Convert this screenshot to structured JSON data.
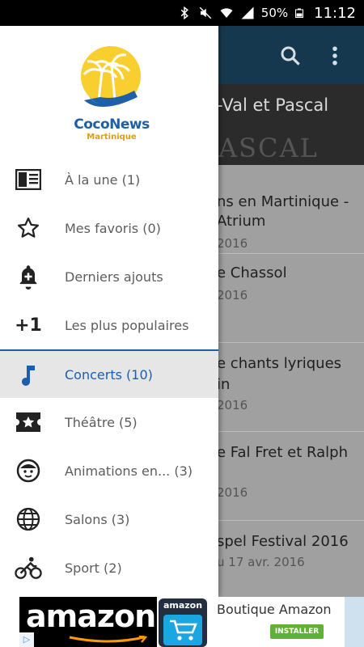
{
  "status_bar": {
    "battery": "50%",
    "time": "11:12",
    "icons": [
      "bluetooth-icon",
      "mute-icon",
      "wifi-icon",
      "signal-icon",
      "battery-icon"
    ]
  },
  "background": {
    "hero_title": "-Val et Pascal",
    "hero_deco": "ASCAL",
    "cards": [
      {
        "title_line1": "ns en Martinique -",
        "title_line2": " Atrium",
        "date": "2016"
      },
      {
        "title_line1": "e Chassol",
        "title_line2": "",
        "date": "2016"
      },
      {
        "title_line1": "e chants lyriques",
        "title_line2": "in",
        "date": "2016"
      },
      {
        "title_line1": "e Fal Fret et Ralph",
        "title_line2": "",
        "date": "2016"
      },
      {
        "title_line1": "spel Festival 2016",
        "title_line2": "",
        "date": "u 17 avr. 2016"
      }
    ]
  },
  "drawer": {
    "logo": {
      "brand": "CocoNews",
      "region": "Martinique"
    },
    "items": [
      {
        "label": "À la une (1)",
        "icon": "newspaper-icon"
      },
      {
        "label": "Mes favoris (0)",
        "icon": "star-icon"
      },
      {
        "label": "Derniers ajouts",
        "icon": "bell-plus-icon"
      },
      {
        "label": "Les plus populaires",
        "icon": "plus-one-icon",
        "icon_text": "+1"
      },
      {
        "label": "Concerts (10)",
        "icon": "music-note-icon"
      },
      {
        "label": "Théâtre (5)",
        "icon": "ticket-star-icon"
      },
      {
        "label": "Animations en... (3)",
        "icon": "child-face-icon"
      },
      {
        "label": "Salons (3)",
        "icon": "globe-icon"
      },
      {
        "label": "Sport (2)",
        "icon": "bike-icon"
      }
    ],
    "active_index": 4
  },
  "ad": {
    "brand_word": "amazon",
    "app_icon_word": "amazon",
    "headline": "Boutique Amazon",
    "cta": "INSTALLER"
  },
  "colors": {
    "accent": "#1a5fad",
    "appbar": "#16384f",
    "install_button": "#5fb236"
  }
}
